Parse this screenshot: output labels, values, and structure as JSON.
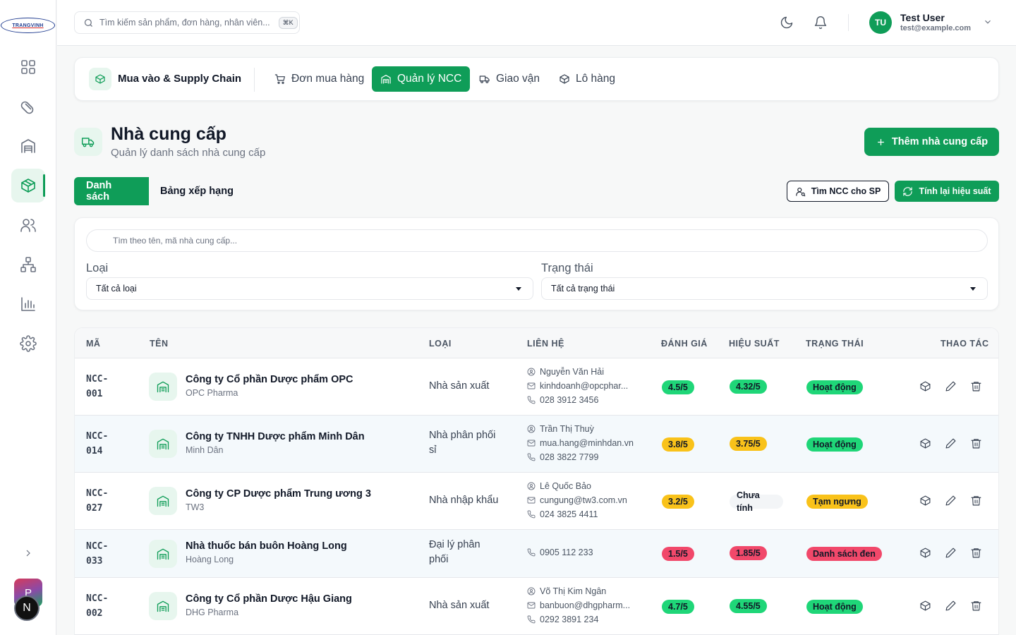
{
  "brand": {
    "logo_text": "TRANGVINH"
  },
  "sidebar": {
    "items": [
      {
        "name": "dashboard",
        "icon": "grid-icon"
      },
      {
        "name": "medicine",
        "icon": "pill-icon"
      },
      {
        "name": "warehouse",
        "icon": "warehouse-icon"
      },
      {
        "name": "supply-chain",
        "icon": "box-icon",
        "active": true
      },
      {
        "name": "users",
        "icon": "users-icon"
      },
      {
        "name": "organization",
        "icon": "network-icon"
      },
      {
        "name": "reports",
        "icon": "chart-icon"
      },
      {
        "name": "settings",
        "icon": "gear-icon"
      }
    ],
    "avatar_p": "P",
    "avatar_n": "N"
  },
  "header": {
    "search_placeholder": "Tìm kiếm sản phẩm, đơn hàng, nhân viên...",
    "shortcut": "⌘K",
    "user": {
      "initials": "TU",
      "name": "Test User",
      "email": "test@example.com"
    }
  },
  "module": {
    "title": "Mua vào & Supply Chain",
    "tabs": [
      {
        "label": "Đơn mua hàng",
        "icon": "cart-icon"
      },
      {
        "label": "Quản lý NCC",
        "icon": "building-icon",
        "active": true
      },
      {
        "label": "Giao vận",
        "icon": "truck-icon"
      },
      {
        "label": "Lô hàng",
        "icon": "box-icon"
      }
    ]
  },
  "page": {
    "title": "Nhà cung cấp",
    "subtitle": "Quản lý danh sách nhà cung cấp",
    "add_button": "Thêm nhà cung cấp",
    "tabs": {
      "list": "Danh sách",
      "ranking": "Bảng xếp hạng"
    },
    "find_button": "Tìm NCC cho SP",
    "recalc_button": "Tính lại hiệu suất"
  },
  "filters": {
    "search_placeholder": "Tìm theo tên, mã nhà cung cấp...",
    "type_label": "Loại",
    "type_value": "Tất cả loại",
    "status_label": "Trạng thái",
    "status_value": "Tất cả trạng thái"
  },
  "table": {
    "columns": [
      "MÃ",
      "TÊN",
      "LOẠI",
      "LIÊN HỆ",
      "ĐÁNH GIÁ",
      "HIỆU SUẤT",
      "TRẠNG THÁI",
      "THAO TÁC"
    ],
    "rows": [
      {
        "code1": "NCC-",
        "code2": "001",
        "name": "Công ty Cổ phần Dược phẩm OPC",
        "short": "OPC Pharma",
        "type1": "Nhà sản xuất",
        "type2": "",
        "contact_person": "Nguyễn Văn Hải",
        "email": "kinhdoanh@opcphar...",
        "phone": "028 3912 3456",
        "rating": "4.5/5",
        "rating_color": "#1fd678",
        "perf": "4.32/5",
        "perf_color": "#1fd678",
        "status": "Hoạt động",
        "status_color": "#1fd678"
      },
      {
        "code1": "NCC-",
        "code2": "014",
        "name": "Công ty TNHH Dược phẩm Minh Dân",
        "short": "Minh Dân",
        "type1": "Nhà phân phối",
        "type2": "sỉ",
        "contact_person": "Trần Thị Thuỳ",
        "email": "mua.hang@minhdan.vn",
        "phone": "028 3822 7799",
        "rating": "3.8/5",
        "rating_color": "#f9c21a",
        "perf": "3.75/5",
        "perf_color": "#f9c21a",
        "status": "Hoạt động",
        "status_color": "#1fd678"
      },
      {
        "code1": "NCC-",
        "code2": "027",
        "name": "Công ty CP Dược phẩm Trung ương 3",
        "short": "TW3",
        "type1": "Nhà nhập khẩu",
        "type2": "",
        "contact_person": "Lê Quốc Bảo",
        "email": "cungung@tw3.com.vn",
        "phone": "024 3825 4411",
        "rating": "3.2/5",
        "rating_color": "#f9c21a",
        "perf1": "Chưa",
        "perf2": "tính",
        "status": "Tạm ngưng",
        "status_color": "#f9c21a"
      },
      {
        "code1": "NCC-",
        "code2": "033",
        "name": "Nhà thuốc bán buôn Hoàng Long",
        "short": "Hoàng Long",
        "type1": "Đại lý phân",
        "type2": "phối",
        "phone": "0905 112 233",
        "rating": "1.5/5",
        "rating_color": "#f1486a",
        "perf": "1.85/5",
        "perf_color": "#f1486a",
        "status": "Danh sách đen",
        "status_color": "#f1486a"
      },
      {
        "code1": "NCC-",
        "code2": "002",
        "name": "Công ty Cổ phần Dược Hậu Giang",
        "short": "DHG Pharma",
        "type1": "Nhà sản xuất",
        "type2": "",
        "contact_person": "Võ Thị Kim Ngân",
        "email": "banbuon@dhgpharm...",
        "phone": "0292 3891 234",
        "rating": "4.7/5",
        "rating_color": "#1fd678",
        "perf": "4.55/5",
        "perf_color": "#1fd678",
        "status": "Hoạt động",
        "status_color": "#1fd678"
      }
    ]
  }
}
